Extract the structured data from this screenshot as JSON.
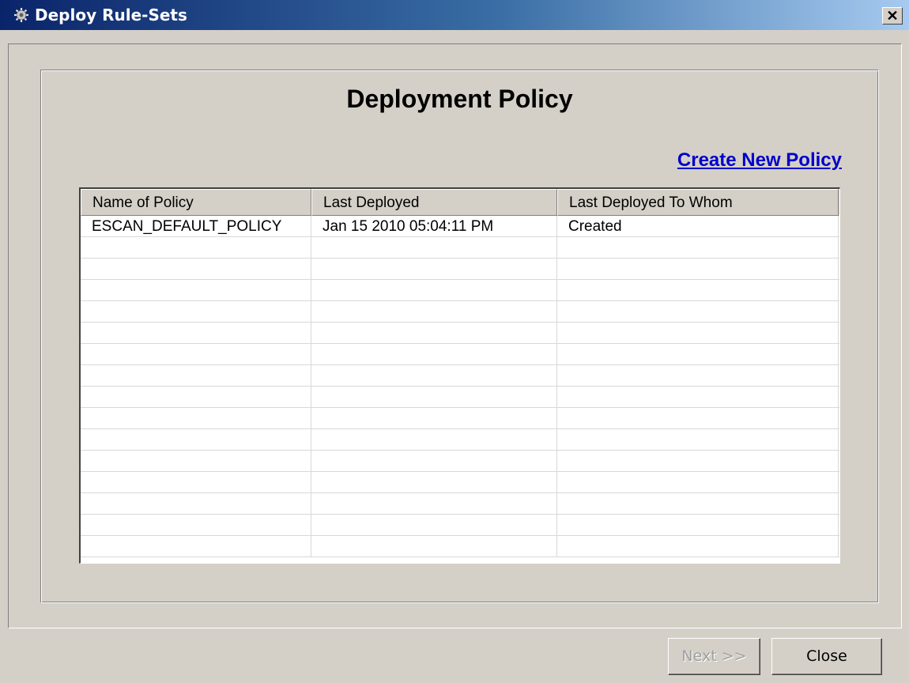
{
  "window": {
    "title": "Deploy Rule-Sets",
    "icon": "gear-icon",
    "close_glyph": "✕"
  },
  "main": {
    "heading": "Deployment Policy",
    "create_link": "Create New Policy"
  },
  "table": {
    "columns": [
      "Name of Policy",
      "Last Deployed",
      "Last Deployed To Whom"
    ],
    "rows": [
      [
        "ESCAN_DEFAULT_POLICY",
        "Jan 15 2010 05:04:11 PM",
        "Created"
      ],
      [
        "",
        "",
        ""
      ],
      [
        "",
        "",
        ""
      ],
      [
        "",
        "",
        ""
      ],
      [
        "",
        "",
        ""
      ],
      [
        "",
        "",
        ""
      ],
      [
        "",
        "",
        ""
      ],
      [
        "",
        "",
        ""
      ],
      [
        "",
        "",
        ""
      ],
      [
        "",
        "",
        ""
      ],
      [
        "",
        "",
        ""
      ],
      [
        "",
        "",
        ""
      ],
      [
        "",
        "",
        ""
      ],
      [
        "",
        "",
        ""
      ],
      [
        "",
        "",
        ""
      ],
      [
        "",
        "",
        ""
      ]
    ]
  },
  "footer": {
    "next_label": "Next >>",
    "close_label": "Close"
  },
  "colors": {
    "title_start": "#0a246a",
    "title_end": "#a6caf0",
    "link": "#0000cc",
    "face": "#d4d0c8"
  }
}
